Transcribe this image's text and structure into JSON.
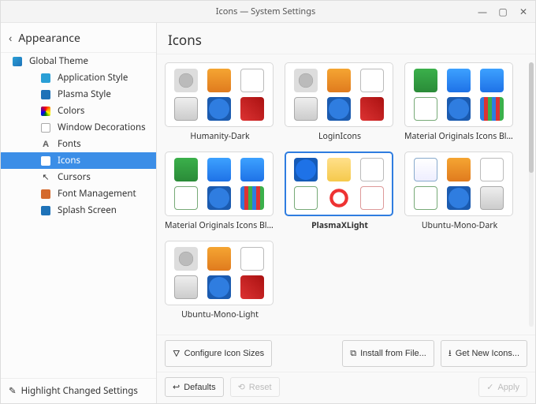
{
  "window": {
    "title": "Icons — System Settings"
  },
  "sidebar": {
    "back_label": "Appearance",
    "items": [
      {
        "label": "Global Theme"
      },
      {
        "label": "Application Style"
      },
      {
        "label": "Plasma Style"
      },
      {
        "label": "Colors"
      },
      {
        "label": "Window Decorations"
      },
      {
        "label": "Fonts"
      },
      {
        "label": "Icons"
      },
      {
        "label": "Cursors"
      },
      {
        "label": "Font Management"
      },
      {
        "label": "Splash Screen"
      }
    ],
    "footer": "Highlight Changed Settings"
  },
  "main": {
    "title": "Icons",
    "themes": [
      {
        "label": "Humanity-Dark"
      },
      {
        "label": "LoginIcons"
      },
      {
        "label": "Material Originals Icons Blue"
      },
      {
        "label": "Material Originals Icons Blu..."
      },
      {
        "label": "PlasmaXLight"
      },
      {
        "label": "Ubuntu-Mono-Dark"
      },
      {
        "label": "Ubuntu-Mono-Light"
      }
    ],
    "selected_index": 4,
    "actions": {
      "configure_sizes": "Configure Icon Sizes",
      "install_file": "Install from File...",
      "get_new": "Get New Icons..."
    },
    "footer": {
      "defaults": "Defaults",
      "reset": "Reset",
      "apply": "Apply"
    }
  }
}
